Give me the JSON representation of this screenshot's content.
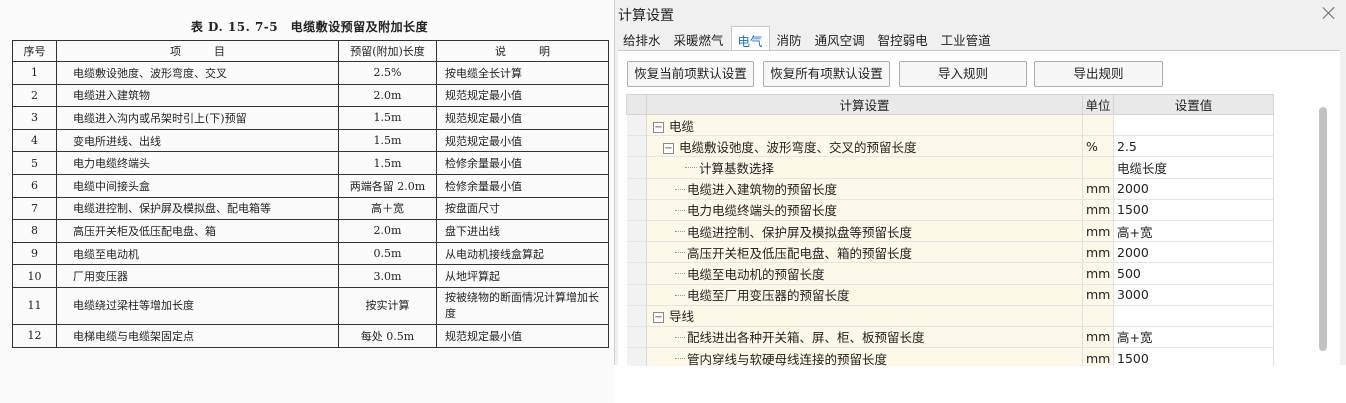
{
  "document": {
    "title": "表 D. 15. 7-5　电缆敷设预留及附加长度",
    "headers": [
      "序号",
      "项　　　目",
      "预留(附加)长度",
      "说　　　明"
    ],
    "rows": [
      {
        "no": "1",
        "item": "电缆敷设弛度、波形弯度、交叉",
        "length": "2.5%",
        "note": "按电缆全长计算"
      },
      {
        "no": "2",
        "item": "电缆进入建筑物",
        "length": "2.0m",
        "note": "规范规定最小值"
      },
      {
        "no": "3",
        "item": "电缆进入沟内或吊架时引上(下)预留",
        "length": "1.5m",
        "note": "规范规定最小值"
      },
      {
        "no": "4",
        "item": "变电所进线、出线",
        "length": "1.5m",
        "note": "规范规定最小值"
      },
      {
        "no": "5",
        "item": "电力电缆终端头",
        "length": "1.5m",
        "note": "检修余量最小值"
      },
      {
        "no": "6",
        "item": "电缆中间接头盒",
        "length": "两端各留 2.0m",
        "note": "检修余量最小值"
      },
      {
        "no": "7",
        "item": "电缆进控制、保护屏及模拟盘、配电箱等",
        "length": "高＋宽",
        "note": "按盘面尺寸"
      },
      {
        "no": "8",
        "item": "高压开关柜及低压配电盘、箱",
        "length": "2.0m",
        "note": "盘下进出线"
      },
      {
        "no": "9",
        "item": "电缆至电动机",
        "length": "0.5m",
        "note": "从电动机接线盒算起"
      },
      {
        "no": "10",
        "item": "厂用变压器",
        "length": "3.0m",
        "note": "从地坪算起"
      },
      {
        "no": "11",
        "item": "电缆绕过梁柱等增加长度",
        "length": "按实计算",
        "note": "按被绕物的断面情况计算增加长度"
      },
      {
        "no": "12",
        "item": "电梯电缆与电缆架固定点",
        "length": "每处 0.5m",
        "note": "规范规定最小值"
      }
    ]
  },
  "dialog": {
    "title": "计算设置",
    "tabs": [
      "给排水",
      "采暖燃气",
      "电气",
      "消防",
      "通风空调",
      "智控弱电",
      "工业管道"
    ],
    "active_tab": "电气",
    "buttons": {
      "restore_current": "恢复当前项默认设置",
      "restore_all": "恢复所有项默认设置",
      "import": "导入规则",
      "export": "导出规则"
    },
    "grid_headers": {
      "setting": "计算设置",
      "unit": "单位",
      "value": "设置值"
    },
    "rows": [
      {
        "name": "电缆",
        "unit": "",
        "value": "",
        "expander": "−"
      },
      {
        "name": "电缆敷设弛度、波形弯度、交叉的预留长度",
        "unit": "%",
        "value": "2.5",
        "expander": "−"
      },
      {
        "name": "计算基数选择",
        "unit": "",
        "value": "电缆长度",
        "expander": ""
      },
      {
        "name": "电缆进入建筑物的预留长度",
        "unit": "mm",
        "value": "2000",
        "expander": ""
      },
      {
        "name": "电力电缆终端头的预留长度",
        "unit": "mm",
        "value": "1500",
        "expander": ""
      },
      {
        "name": "电缆进控制、保护屏及模拟盘等预留长度",
        "unit": "mm",
        "value": "高+宽",
        "expander": ""
      },
      {
        "name": "高压开关柜及低压配电盘、箱的预留长度",
        "unit": "mm",
        "value": "2000",
        "expander": ""
      },
      {
        "name": "电缆至电动机的预留长度",
        "unit": "mm",
        "value": "500",
        "expander": ""
      },
      {
        "name": "电缆至厂用变压器的预留长度",
        "unit": "mm",
        "value": "3000",
        "expander": ""
      },
      {
        "name": "导线",
        "unit": "",
        "value": "",
        "expander": "−"
      },
      {
        "name": "配线进出各种开关箱、屏、柜、板预留长度",
        "unit": "mm",
        "value": "高+宽",
        "expander": ""
      },
      {
        "name": "管内穿线与软硬母线连接的预留长度",
        "unit": "mm",
        "value": "1500",
        "expander": ""
      }
    ]
  }
}
